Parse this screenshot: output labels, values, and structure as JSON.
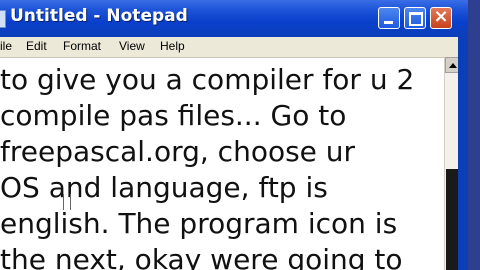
{
  "window": {
    "title": "Untitled - Notepad",
    "controls": {
      "minimize": "minimize",
      "maximize": "maximize",
      "close": "×"
    }
  },
  "menu": {
    "items": [
      {
        "label": "ile"
      },
      {
        "label": "Edit"
      },
      {
        "label": "Format"
      },
      {
        "label": "View"
      },
      {
        "label": "Help"
      }
    ]
  },
  "editor": {
    "lines": [
      "to give you a compiler for u 2",
      "compile pas files... Go to",
      "freepascal.org, choose ur",
      "OS and language, ftp is",
      "english. The program icon is",
      "the next, okay were going to"
    ]
  },
  "colors": {
    "titlebar": "#0a3fcc",
    "close_button": "#c8411c",
    "editor_background": "#ffffff",
    "text": "#111111"
  }
}
